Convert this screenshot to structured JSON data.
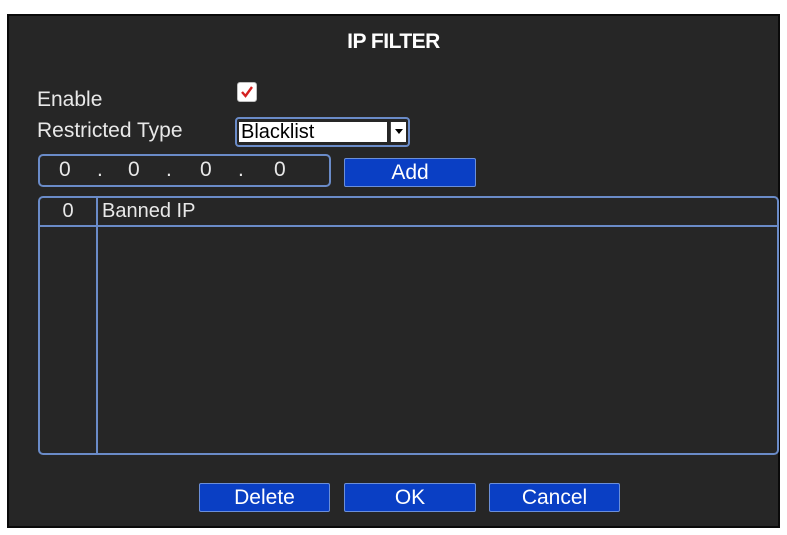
{
  "dialog": {
    "title": "IP FILTER"
  },
  "enable": {
    "label": "Enable",
    "checked": true
  },
  "restricted_type": {
    "label": "Restricted Type",
    "value": "Blacklist"
  },
  "ip_input": {
    "octets": [
      "0",
      "0",
      "0",
      "0"
    ],
    "separator": "."
  },
  "buttons": {
    "add": "Add",
    "delete": "Delete",
    "ok": "OK",
    "cancel": "Cancel"
  },
  "banned_list": {
    "count": "0",
    "header": "Banned IP",
    "items": []
  },
  "colors": {
    "background": "#262626",
    "border": "#6a8bc8",
    "button": "#0a3fc4",
    "check": "#d42020"
  }
}
